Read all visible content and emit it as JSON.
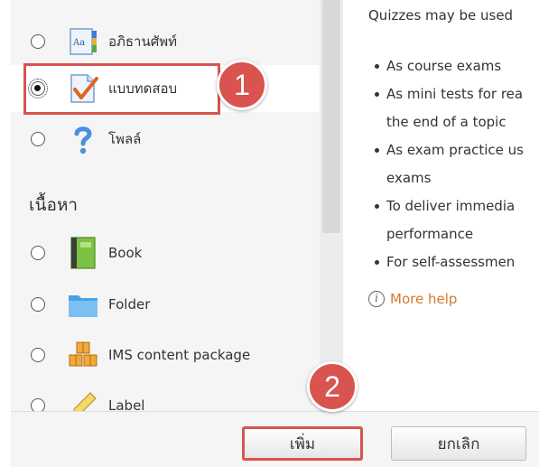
{
  "activities": [
    {
      "label": "อภิธานศัพท์",
      "icon": "glossary-icon",
      "checked": false
    },
    {
      "label": "แบบทดสอบ",
      "icon": "quiz-icon",
      "checked": true
    },
    {
      "label": "โพลล์",
      "icon": "poll-question-icon",
      "checked": false
    }
  ],
  "resources_heading": "เนื้อหา",
  "resources": [
    {
      "label": "Book",
      "icon": "book-icon",
      "checked": false
    },
    {
      "label": "Folder",
      "icon": "folder-icon",
      "checked": false
    },
    {
      "label": "IMS content package",
      "icon": "ims-package-icon",
      "checked": false
    },
    {
      "label": "Label",
      "icon": "label-pencil-icon",
      "checked": false
    }
  ],
  "help": {
    "intro": "Quizzes may be used",
    "bullets": [
      [
        "As course exams"
      ],
      [
        "As mini tests for rea",
        "the end of a topic"
      ],
      [
        "As exam practice us",
        "exams"
      ],
      [
        "To deliver immedia",
        "performance"
      ],
      [
        "For self-assessmen"
      ]
    ],
    "more_help": "More help"
  },
  "buttons": {
    "add": "เพิ่ม",
    "cancel": "ยกเลิก"
  },
  "steps": [
    "1",
    "2"
  ],
  "colors": {
    "annotation": "#d9534f",
    "link": "#d07b2b"
  }
}
